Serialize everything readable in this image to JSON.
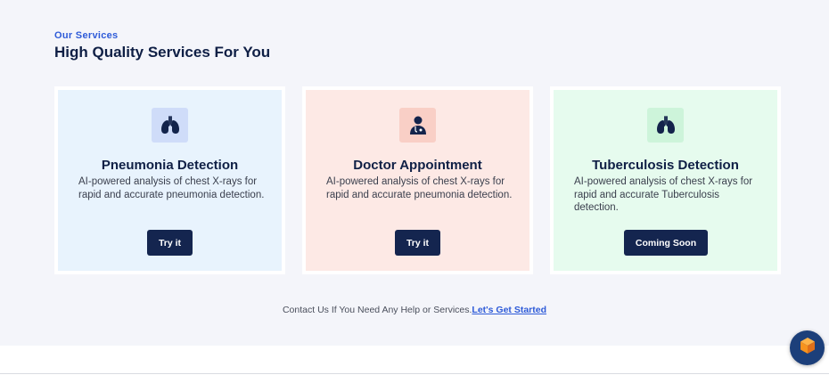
{
  "section": {
    "eyebrow": "Our Services",
    "heading": "High Quality Services For You"
  },
  "cards": [
    {
      "title": "Pneumonia Detection",
      "description": "AI-powered analysis of chest X-rays for rapid and accurate pneumonia detection.",
      "button_label": "Try it",
      "icon": "lungs-icon",
      "bg_color": "#e8f3fd"
    },
    {
      "title": "Doctor Appointment",
      "description": "AI-powered analysis of chest X-rays for rapid and accurate pneumonia detection.",
      "button_label": "Try it",
      "icon": "doctor-icon",
      "bg_color": "#fde9e5"
    },
    {
      "title": "Tuberculosis Detection",
      "description": "AI-powered analysis of chest X-rays for rapid and accurate Tuberculosis detection.",
      "button_label": "Coming Soon",
      "icon": "lungs-icon",
      "bg_color": "#e6fbee"
    }
  ],
  "contact": {
    "text": "Contact Us If You Need Any Help or Services.",
    "link_label": "Let's Get Started"
  },
  "fab": {
    "icon": "cube-icon"
  },
  "colors": {
    "accent": "#2e5bd8",
    "navy": "#14254f",
    "section_bg": "#f4f5fa"
  }
}
